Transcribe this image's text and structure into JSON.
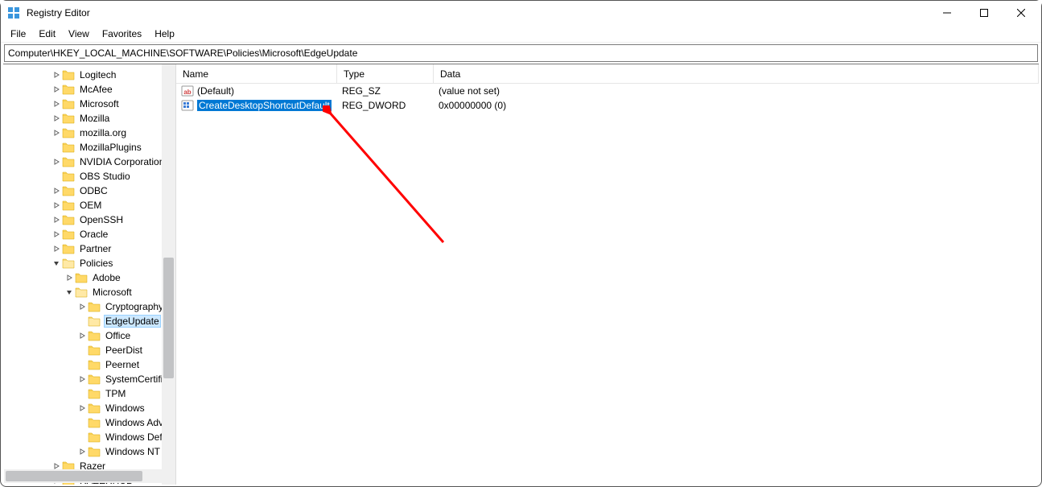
{
  "window": {
    "title": "Registry Editor"
  },
  "menu": {
    "items": [
      "File",
      "Edit",
      "View",
      "Favorites",
      "Help"
    ]
  },
  "addressbar": {
    "path": "Computer\\HKEY_LOCAL_MACHINE\\SOFTWARE\\Policies\\Microsoft\\EdgeUpdate"
  },
  "tree": {
    "items": [
      {
        "indent": 2,
        "expand": "closed",
        "label": "Logitech"
      },
      {
        "indent": 2,
        "expand": "closed",
        "label": "McAfee"
      },
      {
        "indent": 2,
        "expand": "closed",
        "label": "Microsoft"
      },
      {
        "indent": 2,
        "expand": "closed",
        "label": "Mozilla"
      },
      {
        "indent": 2,
        "expand": "closed",
        "label": "mozilla.org"
      },
      {
        "indent": 2,
        "expand": "none",
        "label": "MozillaPlugins"
      },
      {
        "indent": 2,
        "expand": "closed",
        "label": "NVIDIA Corporation"
      },
      {
        "indent": 2,
        "expand": "none",
        "label": "OBS Studio"
      },
      {
        "indent": 2,
        "expand": "closed",
        "label": "ODBC"
      },
      {
        "indent": 2,
        "expand": "closed",
        "label": "OEM"
      },
      {
        "indent": 2,
        "expand": "closed",
        "label": "OpenSSH"
      },
      {
        "indent": 2,
        "expand": "closed",
        "label": "Oracle"
      },
      {
        "indent": 2,
        "expand": "closed",
        "label": "Partner"
      },
      {
        "indent": 2,
        "expand": "open",
        "label": "Policies"
      },
      {
        "indent": 3,
        "expand": "closed",
        "label": "Adobe"
      },
      {
        "indent": 3,
        "expand": "open",
        "label": "Microsoft"
      },
      {
        "indent": 4,
        "expand": "closed",
        "label": "Cryptography"
      },
      {
        "indent": 4,
        "expand": "none",
        "label": "EdgeUpdate",
        "selected": true
      },
      {
        "indent": 4,
        "expand": "closed",
        "label": "Office"
      },
      {
        "indent": 4,
        "expand": "none",
        "label": "PeerDist"
      },
      {
        "indent": 4,
        "expand": "none",
        "label": "Peernet"
      },
      {
        "indent": 4,
        "expand": "closed",
        "label": "SystemCertificates"
      },
      {
        "indent": 4,
        "expand": "none",
        "label": "TPM"
      },
      {
        "indent": 4,
        "expand": "closed",
        "label": "Windows"
      },
      {
        "indent": 4,
        "expand": "none",
        "label": "Windows Advanced Threat Protection"
      },
      {
        "indent": 4,
        "expand": "none",
        "label": "Windows Defender"
      },
      {
        "indent": 4,
        "expand": "closed",
        "label": "Windows NT"
      },
      {
        "indent": 2,
        "expand": "closed",
        "label": "Razer"
      },
      {
        "indent": 2,
        "expand": "closed",
        "label": "RAZERHUD"
      }
    ]
  },
  "list": {
    "columns": [
      "Name",
      "Type",
      "Data"
    ],
    "rows": [
      {
        "icon": "string",
        "name": "(Default)",
        "type": "REG_SZ",
        "data": "(value not set)",
        "selected": false
      },
      {
        "icon": "binary",
        "name": "CreateDesktopShortcutDefault",
        "type": "REG_DWORD",
        "data": "0x00000000 (0)",
        "selected": true
      }
    ]
  }
}
